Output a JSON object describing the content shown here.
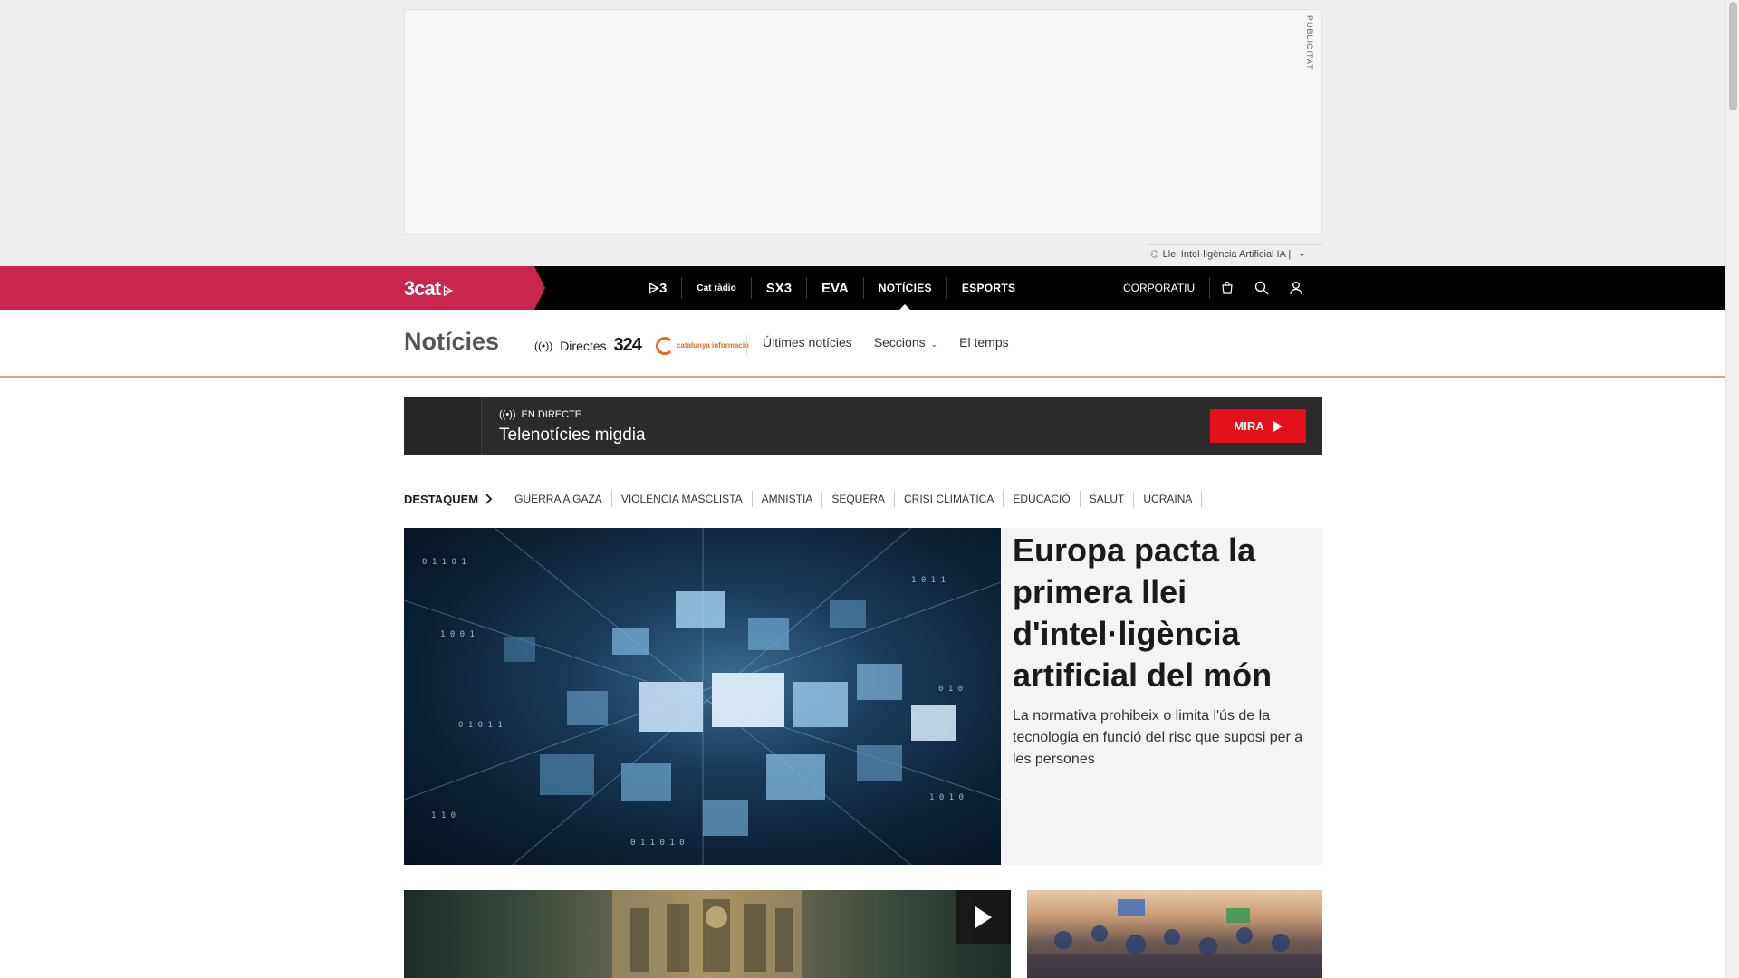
{
  "ad": {
    "label": "PUBLICITAT"
  },
  "trend": {
    "text": "Llei Intel·ligència Artificial IA |"
  },
  "nav": {
    "logo": "3cat",
    "channels": [
      {
        "label": "⩥3",
        "name": "channel-tv3"
      },
      {
        "label": "Cat ràdio",
        "name": "channel-catradio"
      },
      {
        "label": "SX3",
        "name": "channel-sx3"
      },
      {
        "label": "EVA",
        "name": "channel-eva"
      },
      {
        "label": "NOTÍCIES",
        "name": "channel-noticies"
      },
      {
        "label": "ESPORTS",
        "name": "channel-esports"
      }
    ],
    "corporate": "CORPORATIU"
  },
  "section": {
    "title": "Notícies",
    "directes": "Directes",
    "logo_324": "324",
    "logo_ci": "catalunya informació",
    "links": [
      "Últimes notícies",
      "Seccions",
      "El temps"
    ]
  },
  "live": {
    "kicker": "EN DIRECTE",
    "title": "Telenotícies migdia",
    "button": "MIRA"
  },
  "destaquem": {
    "label": "DESTAQUEM",
    "items": [
      "GUERRA A GAZA",
      "VIOLÈNCIA MASCLISTA",
      "AMNISTIA",
      "SEQUERA",
      "CRISI CLIMÀTICA",
      "EDUCACIÓ",
      "SALUT",
      "UCRAÏNA"
    ]
  },
  "hero": {
    "title": "Europa pacta la primera llei d'intel·ligència artificial del món",
    "subtitle": "La normativa prohibeix o limita l'ús de la tecnologia en funció del risc que suposi per a les persones"
  },
  "colors": {
    "accent": "#c8264f",
    "live_red": "#e3101b",
    "brand_orange": "#e96a21"
  }
}
